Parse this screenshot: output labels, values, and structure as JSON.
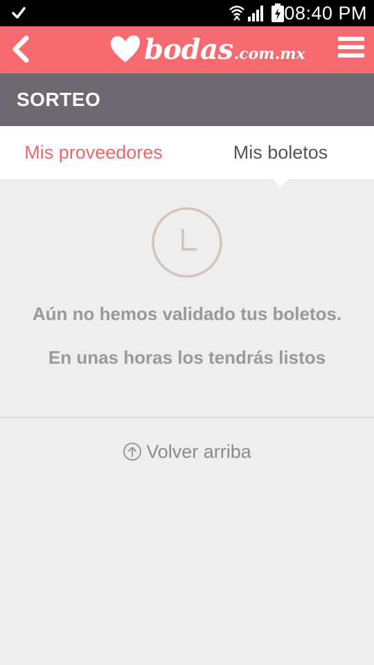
{
  "status": {
    "time": "08:40 PM",
    "icons": [
      "check-icon",
      "wifi-icon",
      "signal-icon",
      "battery-charging-icon"
    ]
  },
  "app_bar": {
    "brand": "bodas",
    "brand_tld": ".com.mx",
    "back_icon": "chevron-left-icon",
    "menu_icon": "hamburger-menu-icon",
    "accent": "#f56b6f"
  },
  "section": {
    "title": "SORTEO",
    "background": "#6e6870"
  },
  "tabs": [
    {
      "label": "Mis proveedores",
      "color": "#e6686c"
    },
    {
      "label": "Mis boletos",
      "active": true
    }
  ],
  "empty_state": {
    "icon": "clock-icon",
    "message": "Aún no hemos validado tus boletos.",
    "submessage": "En unas horas los tendrás listos"
  },
  "footer": {
    "back_to_top": "Volver arriba",
    "icon": "arrow-up-circle-icon"
  }
}
